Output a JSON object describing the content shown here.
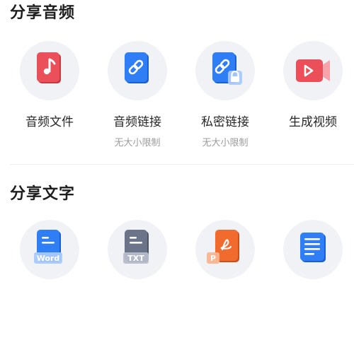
{
  "sections": {
    "audio": {
      "title": "分享音频",
      "items": [
        {
          "label": "音频文件",
          "sublabel": "",
          "icon": "audio-file-icon",
          "color": "#ea4f5a"
        },
        {
          "label": "音频链接",
          "sublabel": "无大小限制",
          "icon": "link-icon",
          "color": "#2f7ef5"
        },
        {
          "label": "私密链接",
          "sublabel": "无大小限制",
          "icon": "private-link-icon",
          "color": "#2f7ef5"
        },
        {
          "label": "生成视频",
          "sublabel": "",
          "icon": "video-camera-icon",
          "color": "#ea4f5a"
        }
      ]
    },
    "text": {
      "title": "分享文字",
      "items": [
        {
          "icon": "word-doc-icon",
          "badge": "Word",
          "color": "#2f7ef5"
        },
        {
          "icon": "txt-doc-icon",
          "badge": "TXT",
          "color": "#6c7489"
        },
        {
          "icon": "pdf-doc-icon",
          "badge": "P",
          "color": "#f26b2e"
        },
        {
          "icon": "text-lines-icon",
          "badge": "",
          "color": "#2f7ef5"
        }
      ]
    }
  }
}
